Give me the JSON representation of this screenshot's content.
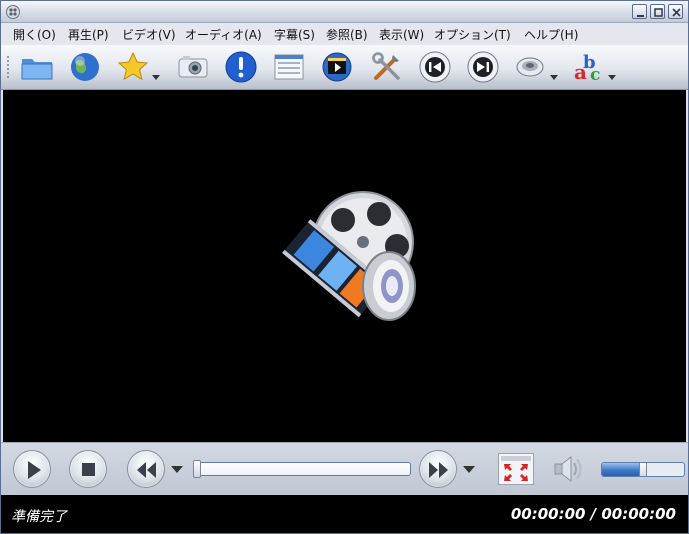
{
  "window": {
    "buttons": [
      "minimize",
      "maximize",
      "close"
    ]
  },
  "menubar": {
    "items": [
      {
        "label": "開く(O)"
      },
      {
        "label": "再生(P)"
      },
      {
        "label": "ビデオ(V)"
      },
      {
        "label": "オーディオ(A)"
      },
      {
        "label": "字幕(S)"
      },
      {
        "label": "参照(B)"
      },
      {
        "label": "表示(W)"
      },
      {
        "label": "オプション(T)"
      },
      {
        "label": "ヘルプ(H)"
      }
    ]
  },
  "toolbar": {
    "buttons": [
      {
        "icon": "folder-open-icon"
      },
      {
        "icon": "globe-url-icon"
      },
      {
        "icon": "favorites-star-icon",
        "has_dropdown": true
      },
      {
        "icon": "screenshot-camera-icon"
      },
      {
        "icon": "info-exclamation-icon"
      },
      {
        "icon": "playlist-icon"
      },
      {
        "icon": "video-equalizer-icon"
      },
      {
        "icon": "preferences-tools-icon"
      },
      {
        "icon": "previous-icon"
      },
      {
        "icon": "next-icon"
      },
      {
        "icon": "audio-track-icon",
        "has_dropdown": true
      },
      {
        "icon": "subtitle-abc-icon",
        "has_dropdown": true
      }
    ]
  },
  "controls": {
    "buttons": [
      "play-icon",
      "stop-icon",
      "rewind-icon",
      "forward-icon",
      "fullscreen-icon",
      "speaker-icon"
    ],
    "seek_position": 0,
    "volume_level": 0.5
  },
  "status": {
    "text": "準備完了",
    "time": "00:00:00 / 00:00:00"
  },
  "colors": {
    "accent": "#3f79c9",
    "video_background": "#000000",
    "toolbar_background": "#e3e7ee"
  }
}
